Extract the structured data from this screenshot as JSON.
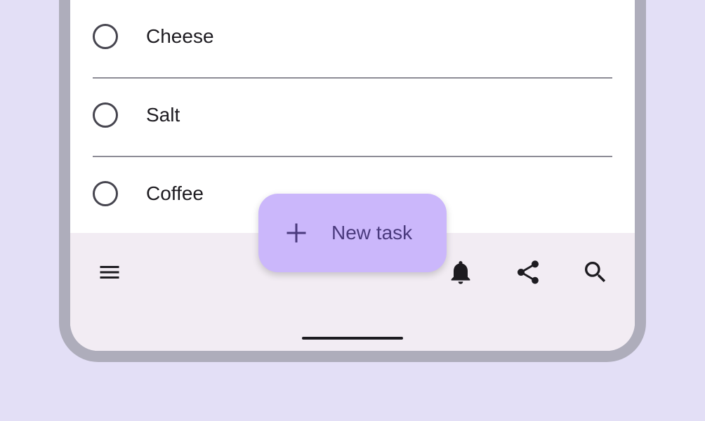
{
  "tasks": [
    {
      "label": "Cheese"
    },
    {
      "label": "Salt"
    },
    {
      "label": "Coffee"
    }
  ],
  "fab": {
    "label": "New task",
    "icon": "plus-icon"
  },
  "bottom_bar": {
    "icons": [
      "menu-icon",
      "bell-icon",
      "share-icon",
      "search-icon"
    ]
  },
  "colors": {
    "background": "#e3dff6",
    "fab": "#cbb7fb",
    "bottom_bar": "#f2ecf3",
    "frame": "#aeadbb"
  }
}
